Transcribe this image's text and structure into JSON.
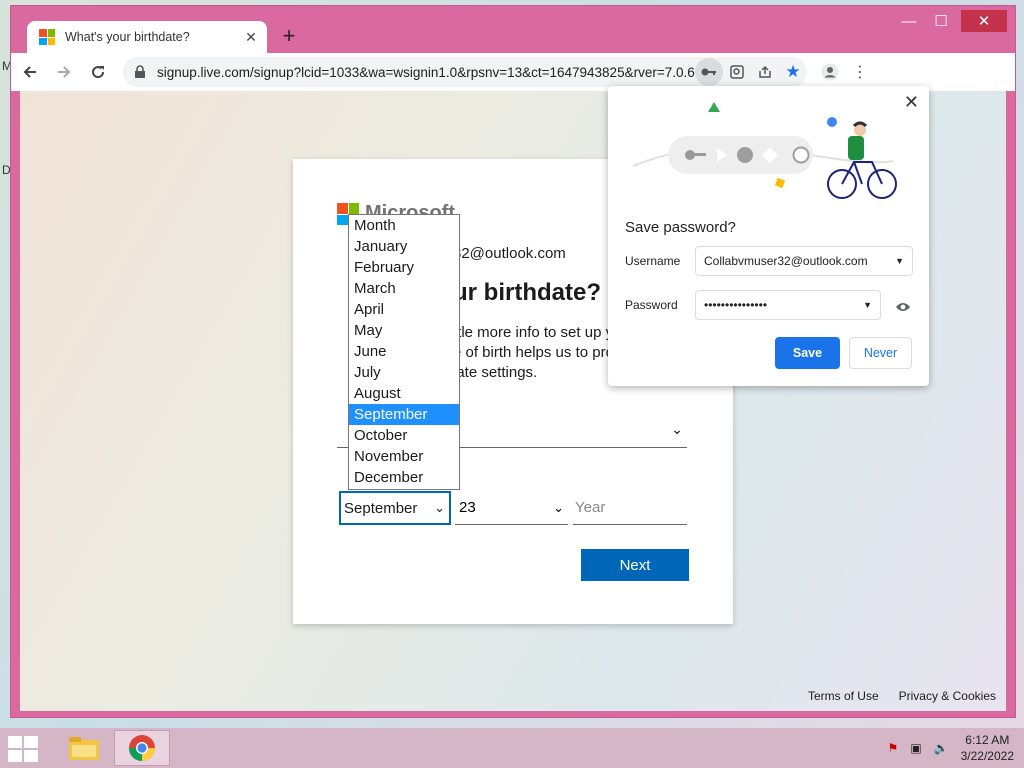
{
  "desktop": {
    "edge_letters": [
      "M",
      "D"
    ]
  },
  "window": {
    "minimize": "—",
    "maximize": "☐",
    "close": "✕"
  },
  "tab": {
    "title": "What's your birthdate?",
    "close": "✕",
    "new_tab": "+"
  },
  "toolbar": {
    "url": "signup.live.com/signup?lcid=1033&wa=wsignin1.0&rpsnv=13&ct=1647943825&rver=7.0.6737.0&wp...",
    "icons": [
      "back-icon",
      "forward-icon",
      "reload-icon",
      "lock-icon",
      "key-icon",
      "zoom-icon",
      "share-icon",
      "star-icon",
      "profile-icon",
      "menu-icon"
    ]
  },
  "signup": {
    "brand": "Microsoft",
    "identity": "Collabvmuser32@outlook.com",
    "identity_visible": "32@outlook.com",
    "heading": "ur birthdate?",
    "desc_lines": [
      "ttle more info to set up y",
      "e of birth helps us to pro",
      "iate settings."
    ],
    "dob": {
      "month": "September",
      "day": "23",
      "year_placeholder": "Year"
    },
    "next_label": "Next"
  },
  "month_dropdown": {
    "options": [
      "Month",
      "January",
      "February",
      "March",
      "April",
      "May",
      "June",
      "July",
      "August",
      "September",
      "October",
      "November",
      "December"
    ],
    "selected": "September"
  },
  "footer": {
    "terms": "Terms of Use",
    "privacy": "Privacy & Cookies"
  },
  "password_popup": {
    "title": "Save password?",
    "username_label": "Username",
    "username_value": "Collabvmuser32@outlook.com",
    "password_label": "Password",
    "password_value": "•••••••••••••••",
    "save_label": "Save",
    "never_label": "Never"
  },
  "taskbar": {
    "time": "6:12 AM",
    "date": "3/22/2022"
  },
  "colors": {
    "window_frame": "#d9699f",
    "ms_blue": "#0067b8",
    "chrome_blue": "#1a73e8",
    "selected_option": "#1e90ff"
  }
}
